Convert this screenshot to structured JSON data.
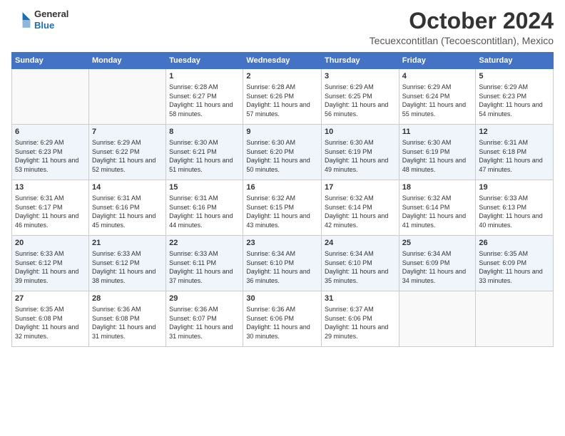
{
  "logo": {
    "line1": "General",
    "line2": "Blue"
  },
  "title": "October 2024",
  "location": "Tecuexcontitlan (Tecoescontitlan), Mexico",
  "days_of_week": [
    "Sunday",
    "Monday",
    "Tuesday",
    "Wednesday",
    "Thursday",
    "Friday",
    "Saturday"
  ],
  "weeks": [
    [
      {
        "day": "",
        "sunrise": "",
        "sunset": "",
        "daylight": ""
      },
      {
        "day": "",
        "sunrise": "",
        "sunset": "",
        "daylight": ""
      },
      {
        "day": "1",
        "sunrise": "Sunrise: 6:28 AM",
        "sunset": "Sunset: 6:27 PM",
        "daylight": "Daylight: 11 hours and 58 minutes."
      },
      {
        "day": "2",
        "sunrise": "Sunrise: 6:28 AM",
        "sunset": "Sunset: 6:26 PM",
        "daylight": "Daylight: 11 hours and 57 minutes."
      },
      {
        "day": "3",
        "sunrise": "Sunrise: 6:29 AM",
        "sunset": "Sunset: 6:25 PM",
        "daylight": "Daylight: 11 hours and 56 minutes."
      },
      {
        "day": "4",
        "sunrise": "Sunrise: 6:29 AM",
        "sunset": "Sunset: 6:24 PM",
        "daylight": "Daylight: 11 hours and 55 minutes."
      },
      {
        "day": "5",
        "sunrise": "Sunrise: 6:29 AM",
        "sunset": "Sunset: 6:23 PM",
        "daylight": "Daylight: 11 hours and 54 minutes."
      }
    ],
    [
      {
        "day": "6",
        "sunrise": "Sunrise: 6:29 AM",
        "sunset": "Sunset: 6:23 PM",
        "daylight": "Daylight: 11 hours and 53 minutes."
      },
      {
        "day": "7",
        "sunrise": "Sunrise: 6:29 AM",
        "sunset": "Sunset: 6:22 PM",
        "daylight": "Daylight: 11 hours and 52 minutes."
      },
      {
        "day": "8",
        "sunrise": "Sunrise: 6:30 AM",
        "sunset": "Sunset: 6:21 PM",
        "daylight": "Daylight: 11 hours and 51 minutes."
      },
      {
        "day": "9",
        "sunrise": "Sunrise: 6:30 AM",
        "sunset": "Sunset: 6:20 PM",
        "daylight": "Daylight: 11 hours and 50 minutes."
      },
      {
        "day": "10",
        "sunrise": "Sunrise: 6:30 AM",
        "sunset": "Sunset: 6:19 PM",
        "daylight": "Daylight: 11 hours and 49 minutes."
      },
      {
        "day": "11",
        "sunrise": "Sunrise: 6:30 AM",
        "sunset": "Sunset: 6:19 PM",
        "daylight": "Daylight: 11 hours and 48 minutes."
      },
      {
        "day": "12",
        "sunrise": "Sunrise: 6:31 AM",
        "sunset": "Sunset: 6:18 PM",
        "daylight": "Daylight: 11 hours and 47 minutes."
      }
    ],
    [
      {
        "day": "13",
        "sunrise": "Sunrise: 6:31 AM",
        "sunset": "Sunset: 6:17 PM",
        "daylight": "Daylight: 11 hours and 46 minutes."
      },
      {
        "day": "14",
        "sunrise": "Sunrise: 6:31 AM",
        "sunset": "Sunset: 6:16 PM",
        "daylight": "Daylight: 11 hours and 45 minutes."
      },
      {
        "day": "15",
        "sunrise": "Sunrise: 6:31 AM",
        "sunset": "Sunset: 6:16 PM",
        "daylight": "Daylight: 11 hours and 44 minutes."
      },
      {
        "day": "16",
        "sunrise": "Sunrise: 6:32 AM",
        "sunset": "Sunset: 6:15 PM",
        "daylight": "Daylight: 11 hours and 43 minutes."
      },
      {
        "day": "17",
        "sunrise": "Sunrise: 6:32 AM",
        "sunset": "Sunset: 6:14 PM",
        "daylight": "Daylight: 11 hours and 42 minutes."
      },
      {
        "day": "18",
        "sunrise": "Sunrise: 6:32 AM",
        "sunset": "Sunset: 6:14 PM",
        "daylight": "Daylight: 11 hours and 41 minutes."
      },
      {
        "day": "19",
        "sunrise": "Sunrise: 6:33 AM",
        "sunset": "Sunset: 6:13 PM",
        "daylight": "Daylight: 11 hours and 40 minutes."
      }
    ],
    [
      {
        "day": "20",
        "sunrise": "Sunrise: 6:33 AM",
        "sunset": "Sunset: 6:12 PM",
        "daylight": "Daylight: 11 hours and 39 minutes."
      },
      {
        "day": "21",
        "sunrise": "Sunrise: 6:33 AM",
        "sunset": "Sunset: 6:12 PM",
        "daylight": "Daylight: 11 hours and 38 minutes."
      },
      {
        "day": "22",
        "sunrise": "Sunrise: 6:33 AM",
        "sunset": "Sunset: 6:11 PM",
        "daylight": "Daylight: 11 hours and 37 minutes."
      },
      {
        "day": "23",
        "sunrise": "Sunrise: 6:34 AM",
        "sunset": "Sunset: 6:10 PM",
        "daylight": "Daylight: 11 hours and 36 minutes."
      },
      {
        "day": "24",
        "sunrise": "Sunrise: 6:34 AM",
        "sunset": "Sunset: 6:10 PM",
        "daylight": "Daylight: 11 hours and 35 minutes."
      },
      {
        "day": "25",
        "sunrise": "Sunrise: 6:34 AM",
        "sunset": "Sunset: 6:09 PM",
        "daylight": "Daylight: 11 hours and 34 minutes."
      },
      {
        "day": "26",
        "sunrise": "Sunrise: 6:35 AM",
        "sunset": "Sunset: 6:09 PM",
        "daylight": "Daylight: 11 hours and 33 minutes."
      }
    ],
    [
      {
        "day": "27",
        "sunrise": "Sunrise: 6:35 AM",
        "sunset": "Sunset: 6:08 PM",
        "daylight": "Daylight: 11 hours and 32 minutes."
      },
      {
        "day": "28",
        "sunrise": "Sunrise: 6:36 AM",
        "sunset": "Sunset: 6:08 PM",
        "daylight": "Daylight: 11 hours and 31 minutes."
      },
      {
        "day": "29",
        "sunrise": "Sunrise: 6:36 AM",
        "sunset": "Sunset: 6:07 PM",
        "daylight": "Daylight: 11 hours and 31 minutes."
      },
      {
        "day": "30",
        "sunrise": "Sunrise: 6:36 AM",
        "sunset": "Sunset: 6:06 PM",
        "daylight": "Daylight: 11 hours and 30 minutes."
      },
      {
        "day": "31",
        "sunrise": "Sunrise: 6:37 AM",
        "sunset": "Sunset: 6:06 PM",
        "daylight": "Daylight: 11 hours and 29 minutes."
      },
      {
        "day": "",
        "sunrise": "",
        "sunset": "",
        "daylight": ""
      },
      {
        "day": "",
        "sunrise": "",
        "sunset": "",
        "daylight": ""
      }
    ]
  ]
}
